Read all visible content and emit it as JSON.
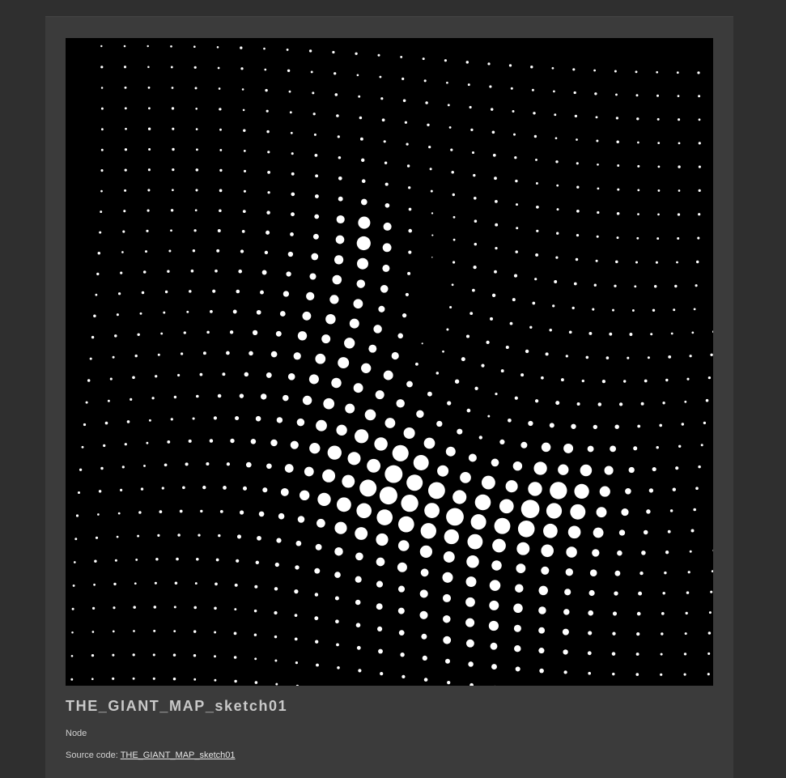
{
  "sketch": {
    "title": "THE_GIANT_MAP_sketch01",
    "description": "Node",
    "source_label": "Source code:",
    "source_link_text": "THE_GIANT_MAP_sketch01"
  },
  "colors": {
    "page_background": "#2f2f2f",
    "panel_background": "#3b3b3b",
    "canvas_background": "#000000",
    "dot_color": "#ffffff",
    "text_color": "#c9c9c9"
  }
}
